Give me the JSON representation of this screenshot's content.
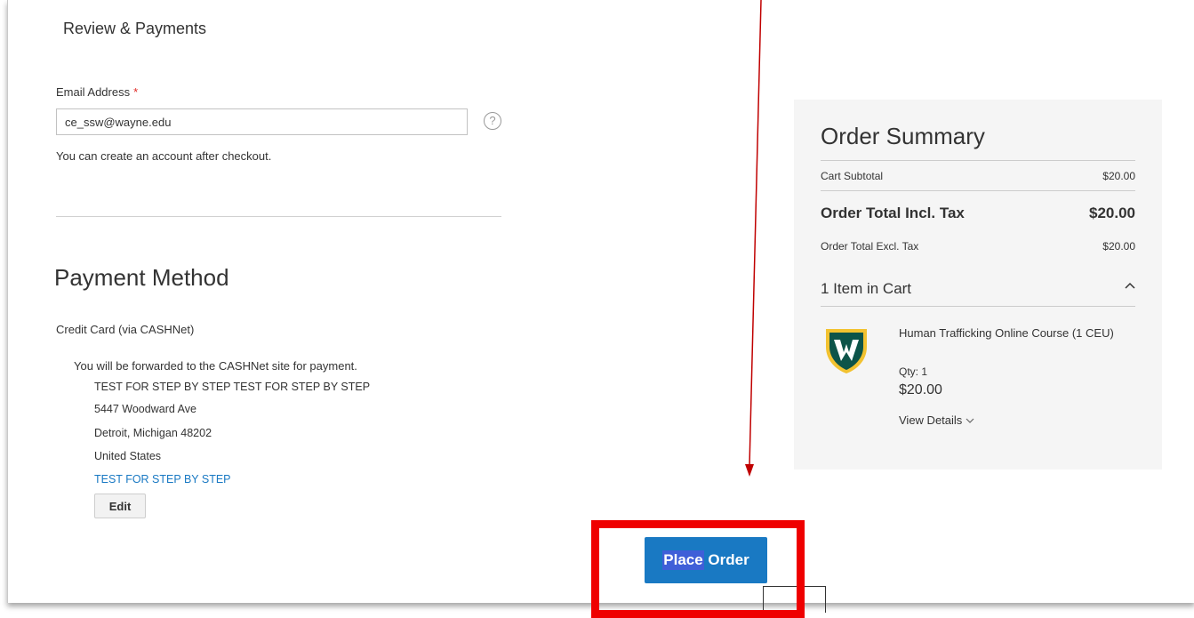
{
  "checkout": {
    "section_title": "Review & Payments",
    "email": {
      "label": "Email Address",
      "required_mark": "*",
      "value": "ce_ssw@wayne.edu",
      "help_icon": "question-circle-icon",
      "note": "You can create an account after checkout."
    },
    "payment": {
      "title": "Payment Method",
      "method_name": "Credit Card (via CASHNet)",
      "note": "You will be forwarded to the CASHNet site for payment.",
      "address": {
        "name": "TEST FOR STEP BY STEP TEST FOR STEP BY STEP",
        "street": "5447 Woodward Ave",
        "city_state_zip": "Detroit, Michigan 48202",
        "country": "United States",
        "link": "TEST FOR STEP BY STEP"
      },
      "edit_label": "Edit"
    },
    "place_order": {
      "label_part1": "Place",
      "label_part2": " Order"
    }
  },
  "summary": {
    "title": "Order Summary",
    "subtotal_label": "Cart Subtotal",
    "subtotal_value": "$20.00",
    "total_incl_label": "Order Total Incl. Tax",
    "total_incl_value": "$20.00",
    "total_excl_label": "Order Total Excl. Tax",
    "total_excl_value": "$20.00",
    "items_label": "1 Item in Cart",
    "collapse_icon": "chevron-up-icon",
    "item": {
      "logo": "wayne-state-w-logo",
      "name": "Human Trafficking Online Course (1 CEU)",
      "qty": "Qty: 1",
      "price": "$20.00",
      "view_details": "View Details"
    }
  },
  "annotations": {
    "highlight_color": "#ef0000",
    "accent_color": "#1979c3"
  }
}
